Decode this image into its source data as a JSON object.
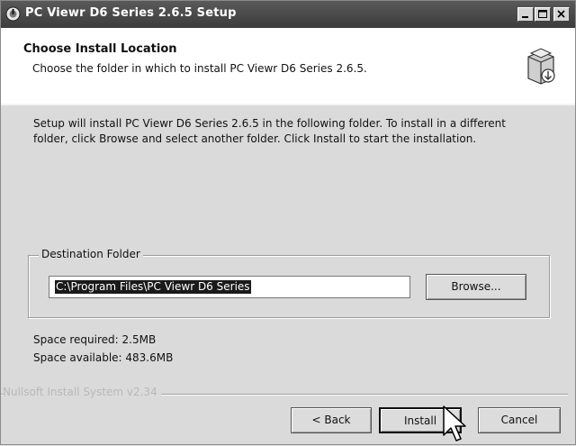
{
  "window": {
    "title": "PC Viewr D6 Series 2.6.5 Setup"
  },
  "titlebar_controls": {
    "minimize_icon": "minimize-icon",
    "maximize_icon": "maximize-icon",
    "close_icon": "close-icon"
  },
  "header": {
    "title": "Choose Install Location",
    "subtitle": "Choose the folder in which to install PC Viewr D6 Series 2.6.5.",
    "icon": "installer-box-icon"
  },
  "content": {
    "intro": "Setup will install PC Viewr D6 Series 2.6.5 in the following folder. To install in a different folder, click Browse and select another folder. Click Install to start the installation.",
    "destination": {
      "legend": "Destination Folder",
      "path": "C:\\Program Files\\PC Viewr D6 Series",
      "browse_label": "Browse..."
    },
    "space_required": "Space required: 2.5MB",
    "space_available": "Space available: 483.6MB"
  },
  "footer": {
    "branding": "Nullsoft Install System v2.34",
    "back_label": "< Back",
    "install_label": "Install",
    "cancel_label": "Cancel"
  },
  "colors": {
    "titlebar": "#3c3c3c",
    "dialog_bg": "#dadada",
    "header_bg": "#ffffff"
  }
}
